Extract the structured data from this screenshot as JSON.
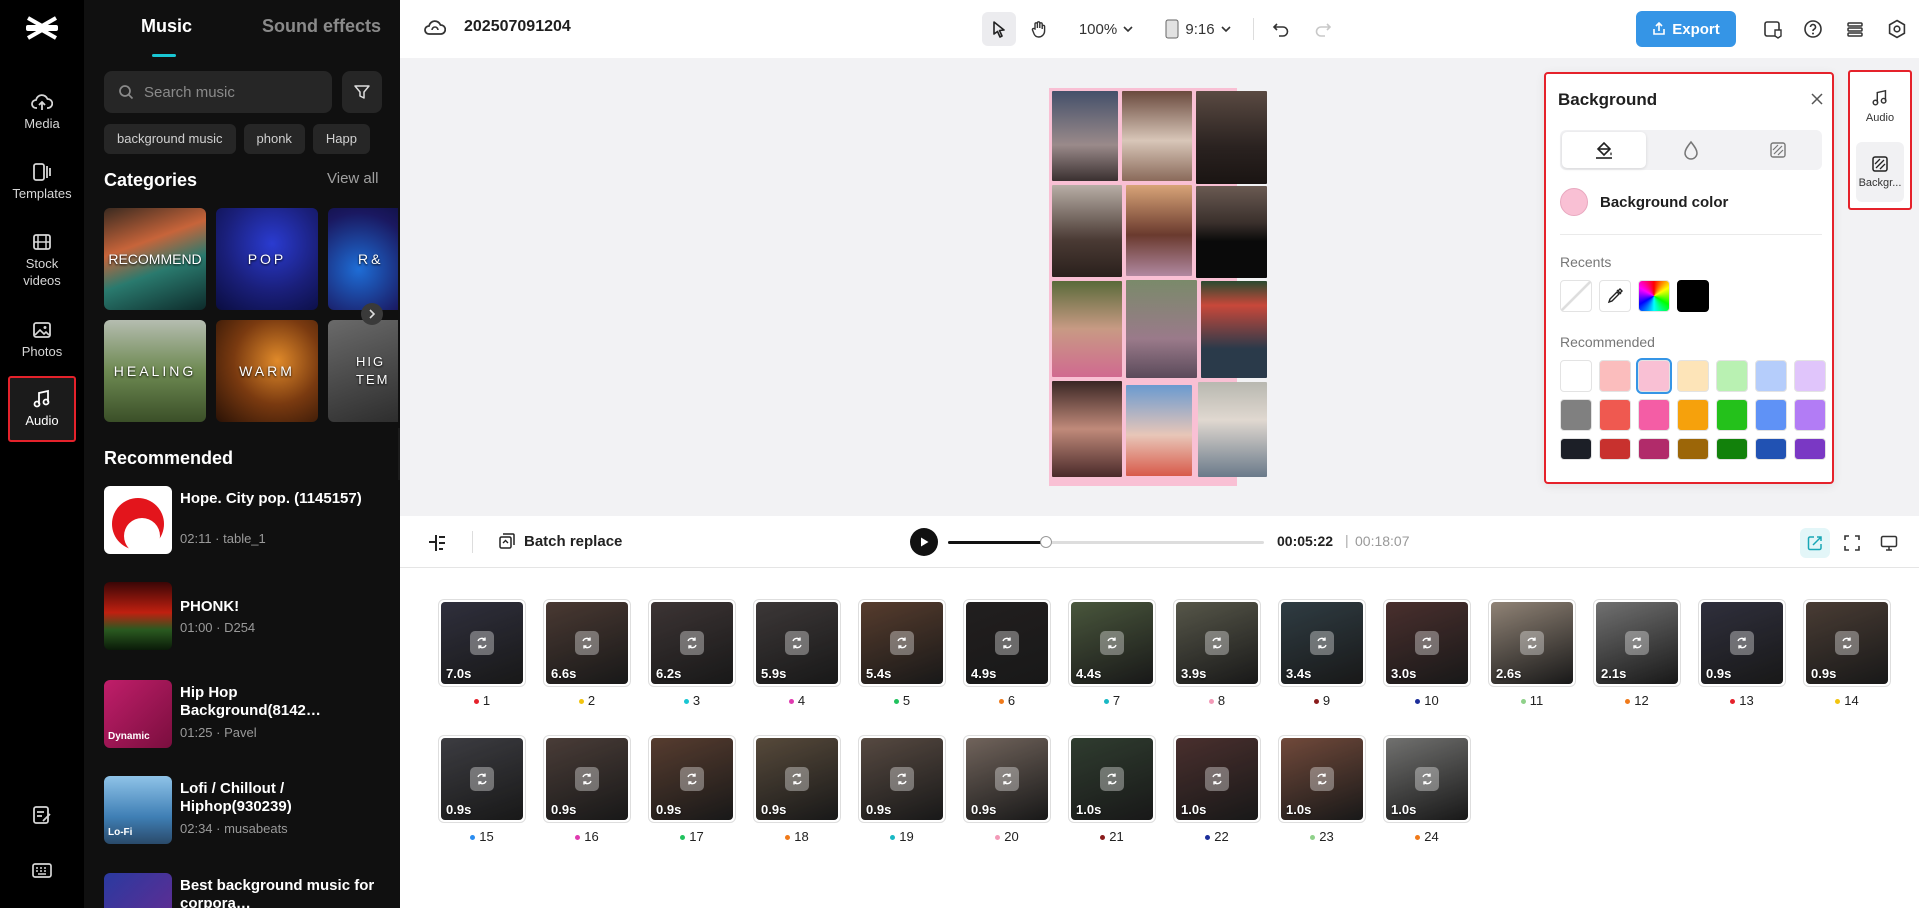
{
  "app": {
    "project_name": "202507091204"
  },
  "rail": {
    "items": [
      {
        "label": "Media"
      },
      {
        "label": "Templates"
      },
      {
        "label": "Stock videos"
      },
      {
        "label": "Photos"
      },
      {
        "label": "Audio"
      }
    ]
  },
  "music_panel": {
    "tabs": [
      "Music",
      "Sound effects"
    ],
    "active_tab": "Music",
    "search_placeholder": "Search music",
    "chips": [
      "background music",
      "phonk",
      "Happ"
    ],
    "categories_title": "Categories",
    "view_all": "View all",
    "categories": [
      "RECOMMEND",
      "POP",
      "R&",
      "HEALING",
      "WARM",
      "HIG TEM"
    ],
    "recommended_title": "Recommended",
    "tracks": [
      {
        "title": "Hope. City pop. (1145157)",
        "meta": "02:11 · table_1"
      },
      {
        "title": "PHONK!",
        "meta": "01:00 · D254"
      },
      {
        "title": "Hip Hop Background(8142…",
        "meta": "01:25 · Pavel",
        "badge": "Dynamic"
      },
      {
        "title": "Lofi / Chillout / Hiphop(930239)",
        "meta": "02:34 · musabeats",
        "badge": "Lo-Fi"
      },
      {
        "title": "Best background music for corpora…",
        "meta": ""
      }
    ]
  },
  "topbar": {
    "zoom": "100%",
    "ratio": "9:16",
    "export_label": "Export"
  },
  "background_panel": {
    "title": "Background",
    "bg_color_label": "Background color",
    "bg_color": "#f9c0d4",
    "recents_label": "Recents",
    "recents": [
      "none",
      "eyedropper",
      "rainbow",
      "#000000"
    ],
    "recommended_label": "Recommended",
    "recommended_colors": [
      [
        "#ffffff",
        "#fbbdbd",
        "#f9c0d4",
        "#fde4b8",
        "#b9f1b2",
        "#b5cdfb",
        "#e0c5fb"
      ],
      [
        "#808080",
        "#ef5950",
        "#f45da5",
        "#f6a10c",
        "#24c11b",
        "#5f92f6",
        "#b27cf5"
      ],
      [
        "#1c1f27",
        "#c8312e",
        "#b12b6a",
        "#9c6608",
        "#12810b",
        "#2152b3",
        "#7a38c4"
      ]
    ],
    "selected_color": "#f9c0d4"
  },
  "side_tabs": [
    {
      "label": "Audio"
    },
    {
      "label": "Backgr..."
    }
  ],
  "playback": {
    "batch_label": "Batch replace",
    "current_time": "00:05:22",
    "total_time": "00:18:07",
    "progress": 0.31
  },
  "clips": [
    {
      "n": "1",
      "dur": "7.0s",
      "dot": "#e5222b"
    },
    {
      "n": "2",
      "dur": "6.6s",
      "dot": "#f2c40f"
    },
    {
      "n": "3",
      "dur": "6.2s",
      "dot": "#19c6d3"
    },
    {
      "n": "4",
      "dur": "5.9s",
      "dot": "#e03ab0"
    },
    {
      "n": "5",
      "dur": "5.4s",
      "dot": "#21c25e"
    },
    {
      "n": "6",
      "dur": "4.9s",
      "dot": "#f07a1a"
    },
    {
      "n": "7",
      "dur": "4.4s",
      "dot": "#19b8c4"
    },
    {
      "n": "8",
      "dur": "3.9s",
      "dot": "#f39ab8"
    },
    {
      "n": "9",
      "dur": "3.4s",
      "dot": "#8a1c1c"
    },
    {
      "n": "10",
      "dur": "3.0s",
      "dot": "#1c2e9a"
    },
    {
      "n": "11",
      "dur": "2.6s",
      "dot": "#8fd18a"
    },
    {
      "n": "12",
      "dur": "2.1s",
      "dot": "#f07a1a"
    },
    {
      "n": "13",
      "dur": "0.9s",
      "dot": "#e5222b"
    },
    {
      "n": "14",
      "dur": "0.9s",
      "dot": "#f2c40f"
    },
    {
      "n": "15",
      "dur": "0.9s",
      "dot": "#2a8cf0"
    },
    {
      "n": "16",
      "dur": "0.9s",
      "dot": "#e03ab0"
    },
    {
      "n": "17",
      "dur": "0.9s",
      "dot": "#21c25e"
    },
    {
      "n": "18",
      "dur": "0.9s",
      "dot": "#f07a1a"
    },
    {
      "n": "19",
      "dur": "0.9s",
      "dot": "#19b8c4"
    },
    {
      "n": "20",
      "dur": "0.9s",
      "dot": "#f39ab8"
    },
    {
      "n": "21",
      "dur": "1.0s",
      "dot": "#8a1c1c"
    },
    {
      "n": "22",
      "dur": "1.0s",
      "dot": "#1c2e9a"
    },
    {
      "n": "23",
      "dur": "1.0s",
      "dot": "#8fd18a"
    },
    {
      "n": "24",
      "dur": "1.0s",
      "dot": "#f07a1a"
    }
  ]
}
